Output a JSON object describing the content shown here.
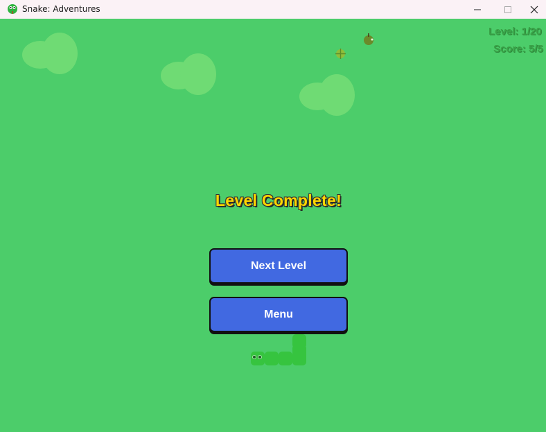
{
  "window": {
    "title": "Snake: Adventures",
    "icon": "snake-icon",
    "controls": [
      "minimize-icon",
      "maximize-icon",
      "close-icon"
    ]
  },
  "hud": {
    "level": "Level: 1/20",
    "score": "Score: 5/5"
  },
  "overlay": {
    "heading": "Level Complete!",
    "buttons": {
      "next_level": "Next Level",
      "menu": "Menu"
    }
  },
  "items": {
    "food": "apple-icon",
    "target": "crosshair-icon"
  },
  "colors": {
    "background": "#4ccd6a",
    "cloud": "#6fdb74",
    "button": "#4169e1",
    "heading": "#ffd700",
    "snake": "#36c43f",
    "titlebar": "#fbf2f6"
  }
}
